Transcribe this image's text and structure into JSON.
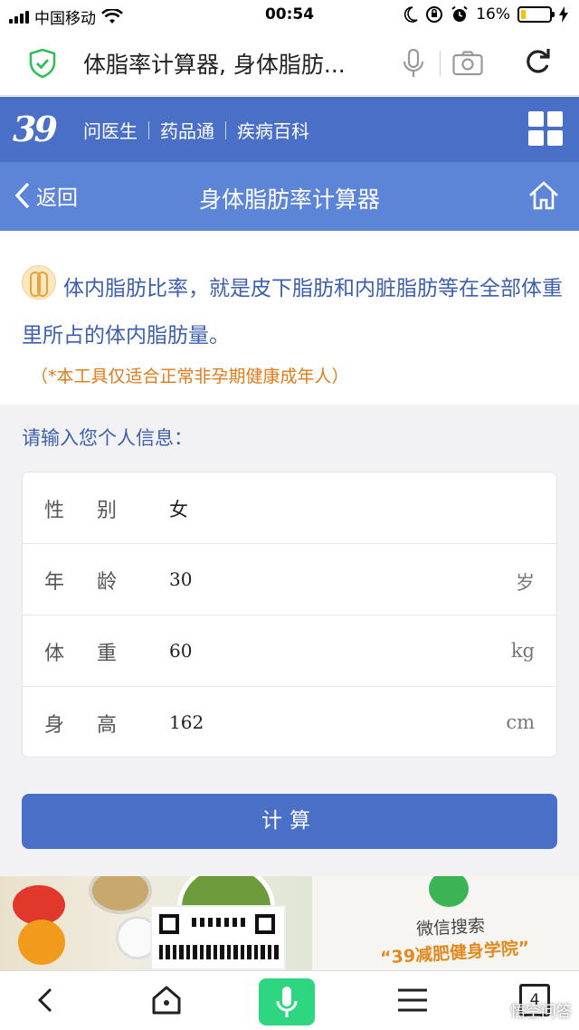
{
  "status_bar": {
    "carrier": "中国移动",
    "time": "00:54",
    "battery_percent": "16%",
    "battery_level": 0.16
  },
  "browser": {
    "title": "体脂率计算器, 身体脂肪...",
    "icons": [
      "shield-check-icon",
      "microphone-icon",
      "camera-icon",
      "reload-icon"
    ]
  },
  "site_header": {
    "logo": "39",
    "nav": [
      "问医生",
      "药品通",
      "疾病百科"
    ],
    "menu_icon": "grid-menu-icon",
    "brand_color": "#4a6fc7"
  },
  "title_bar": {
    "back_label": "返回",
    "heading": "身体脂肪率计算器",
    "home_icon": "home-icon",
    "color": "#5c85d8"
  },
  "intro": {
    "text": "体内脂肪比率，就是皮下脂肪和内脏脂肪等在全部体重里所占的体内脂肪量。",
    "note": "（*本工具仅适合正常非孕期健康成年人）",
    "note_color": "#e07b1a"
  },
  "form": {
    "label": "请输入您个人信息：",
    "rows": [
      {
        "label": "性别",
        "value": "女",
        "unit": ""
      },
      {
        "label": "年龄",
        "value": "30",
        "unit": "岁"
      },
      {
        "label": "体重",
        "value": "60",
        "unit": "kg"
      },
      {
        "label": "身高",
        "value": "162",
        "unit": "cm"
      }
    ],
    "submit_label": "计算"
  },
  "banner": {
    "line1": "微信搜索",
    "line2": "“39减肥健身学院”"
  },
  "bottom_bar": {
    "tab_count": "4",
    "icons": [
      "back-arrow-icon",
      "home-icon",
      "voice-icon",
      "menu-icon",
      "tabs-icon"
    ],
    "voice_color": "#2fd682",
    "watermark": "悟空问答"
  }
}
